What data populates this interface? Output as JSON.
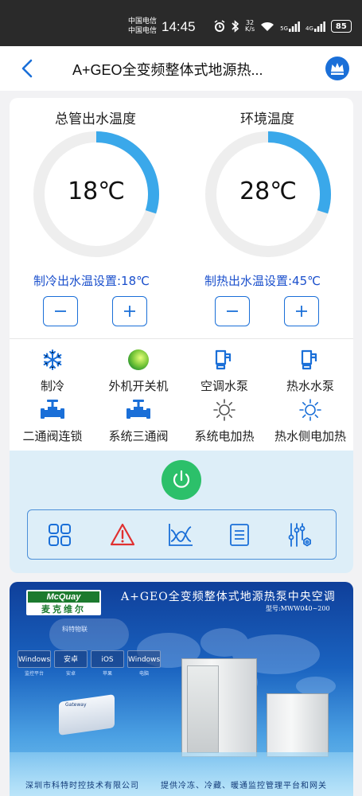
{
  "status_bar": {
    "carrier_1": "中国电信",
    "carrier_2": "中国电信",
    "time": "14:45",
    "net_speed_value": "32",
    "net_speed_unit": "K/s",
    "signal_1": "5G",
    "signal_2": "4G",
    "battery": "85"
  },
  "header": {
    "title": "A+GEO全变频整体式地源热..."
  },
  "gauges": [
    {
      "title": "总管出水温度",
      "value": "18℃",
      "fill_fraction": 0.3
    },
    {
      "title": "环境温度",
      "value": "28℃",
      "fill_fraction": 0.3
    }
  ],
  "setpoints": {
    "cooling": "制冷出水温设置:18℃",
    "heating": "制热出水温设置:45℃",
    "minus": "−",
    "plus": "+"
  },
  "functions": [
    {
      "label": "制冷",
      "icon": "snowflake-icon"
    },
    {
      "label": "外机开关机",
      "icon": "green-ball-icon"
    },
    {
      "label": "空调水泵",
      "icon": "pump-icon"
    },
    {
      "label": "热水水泵",
      "icon": "pump-icon"
    },
    {
      "label": "二通阀连锁",
      "icon": "valve-icon"
    },
    {
      "label": "系统三通阀",
      "icon": "valve-icon"
    },
    {
      "label": "系统电加热",
      "icon": "sun-outline-icon"
    },
    {
      "label": "热水侧电加热",
      "icon": "sun-outline-icon"
    }
  ],
  "toolbar": [
    {
      "icon": "grid-icon"
    },
    {
      "icon": "alarm-triangle-icon"
    },
    {
      "icon": "chart-curve-icon"
    },
    {
      "icon": "document-list-icon"
    },
    {
      "icon": "settings-sliders-icon"
    }
  ],
  "colors": {
    "accent_blue": "#1a6fd8",
    "gauge_arc": "#3aa8ea",
    "power_green": "#2cc06a",
    "alarm_red": "#e03030",
    "setpoint_text": "#1a4fcc"
  },
  "banner": {
    "logo_en": "McQuay",
    "logo_cn": "麦克维尔",
    "title": "A+GEO全变频整体式地源热泵中央空调",
    "model": "型号:MWW040~200",
    "cloud": "科特物联",
    "platforms": [
      "Windows",
      "安卓",
      "iOS",
      "Windows"
    ],
    "platform_labels": [
      "监控平台",
      "安卓",
      "苹果",
      "电脑"
    ],
    "device_label": "Gateway",
    "footer_left": "深圳市科特时控技术有限公司",
    "footer_right": "提供冷冻、冷藏、暖通监控管理平台和网关"
  }
}
